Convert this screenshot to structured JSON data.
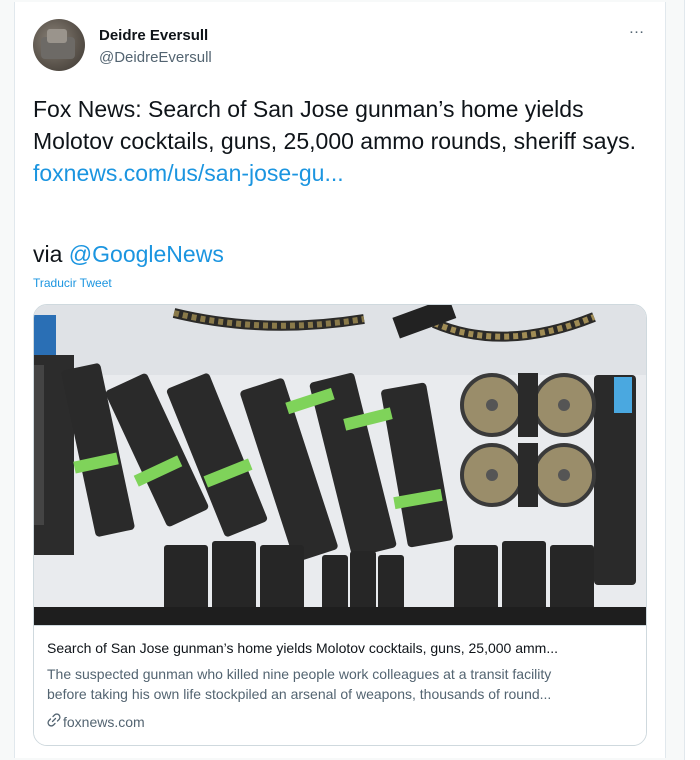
{
  "user": {
    "name": "Deidre Eversull",
    "handle": "@DeidreEversull"
  },
  "menu": {
    "more_icon": "…"
  },
  "tweet": {
    "text": "Fox News: Search of San Jose gunman’s home yields Molotov cocktails, guns, 25,000 ammo rounds, sheriff says.",
    "link": "foxnews.com/us/san-jose-gu...",
    "via_prefix": "via ",
    "via_mention": "@GoogleNews",
    "translate": "Traducir Tweet"
  },
  "card": {
    "title": "Search of San Jose gunman’s home yields Molotov cocktails, guns, 25,000 amm...",
    "description_line1": "The suspected gunman who killed nine people work colleagues at a transit facility",
    "description_line2": "before taking his own life stockpiled an arsenal of weapons, thousands of round...",
    "domain": "foxnews.com",
    "domain_icon": "link-icon"
  },
  "colors": {
    "link": "#1b95e0",
    "text": "#0f1419",
    "muted": "#536471",
    "border": "#cfd9de"
  }
}
